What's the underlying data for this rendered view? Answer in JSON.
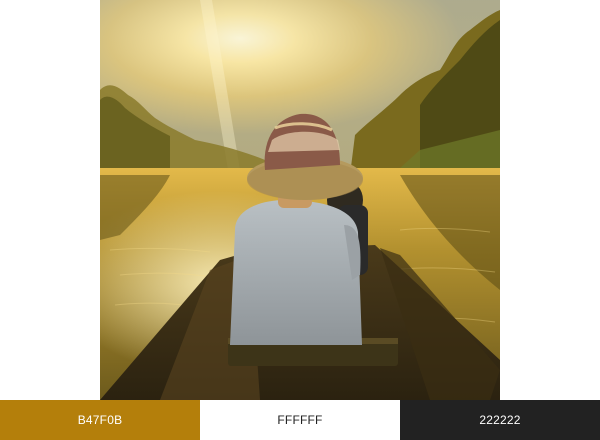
{
  "photo": {
    "description_icon": "photo-canoe-sunrise"
  },
  "palette": {
    "swatches": [
      {
        "hex": "B47F0B",
        "color": "#B47F0B",
        "text_color": "#ffffff"
      },
      {
        "hex": "FFFFFF",
        "color": "#FFFFFF",
        "text_color": "#222222"
      },
      {
        "hex": "222222",
        "color": "#222222",
        "text_color": "#ffffff"
      }
    ]
  }
}
